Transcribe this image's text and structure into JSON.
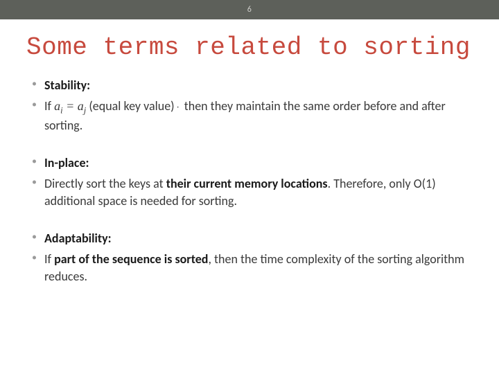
{
  "header": {
    "page_number": "6"
  },
  "title": "Some terms related to sorting",
  "sections": [
    {
      "term": "Stability:",
      "body_pre": "If ",
      "math_ai": "a",
      "math_sub_i": "i",
      "math_eq": " = ",
      "math_aj": "a",
      "math_sub_j": "j",
      "body_paren": " (equal key value)",
      "body_post": " then they maintain the same order before and after sorting."
    },
    {
      "term": "In-place:",
      "body_pre": "Directly sort the keys at ",
      "body_strong": "their current memory locations",
      "body_post": ". Therefore, only O(1) additional space is needed for sorting."
    },
    {
      "term": "Adaptability:",
      "body_pre": "If ",
      "body_strong": "part of the sequence is sorted",
      "body_post": ", then the time complexity of the sorting algorithm reduces."
    }
  ]
}
